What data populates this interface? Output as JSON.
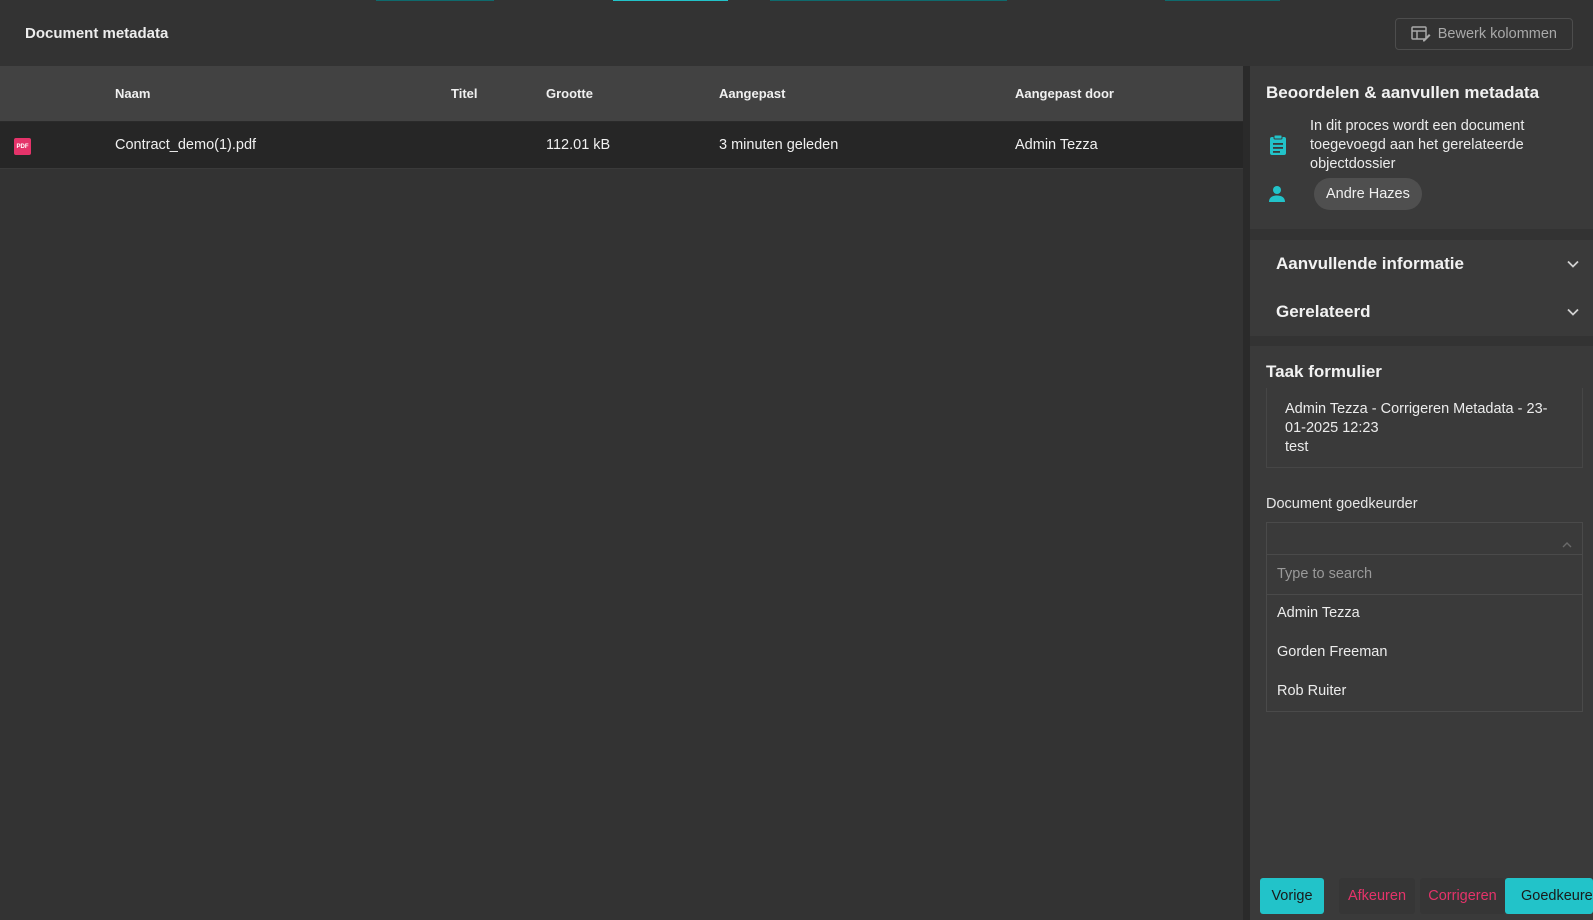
{
  "header": {
    "title": "Document metadata",
    "edit_columns_label": "Bewerk kolommen"
  },
  "table": {
    "columns": {
      "name": "Naam",
      "title": "Titel",
      "size": "Grootte",
      "modified": "Aangepast",
      "modified_by": "Aangepast door"
    },
    "rows": [
      {
        "icon": "pdf-file-icon",
        "icon_label": "PDF",
        "name": "Contract_demo(1).pdf",
        "title": "",
        "size": "112.01 kB",
        "modified": "3 minuten geleden",
        "modified_by": "Admin Tezza"
      }
    ]
  },
  "review_panel": {
    "title": "Beoordelen & aanvullen metadata",
    "description": "In dit proces wordt een document toegevoegd aan het gerelateerde objectdossier",
    "assignee": "Andre Hazes"
  },
  "accordion": {
    "items": [
      {
        "label": "Aanvullende informatie"
      },
      {
        "label": "Gerelateerd"
      }
    ]
  },
  "task_form": {
    "title": "Taak formulier",
    "comment_header": "Admin Tezza - Corrigeren Metadata - 23-01-2025 12:23",
    "comment_body": "test",
    "approver_field_label": "Document goedkeurder",
    "approver_value": "",
    "search_placeholder": "Type to search",
    "options": [
      "Admin Tezza",
      "Gorden Freeman",
      "Rob Ruiter"
    ]
  },
  "actions": {
    "previous": "Vorige",
    "reject": "Afkeuren",
    "correct": "Corrigeren",
    "approve": "Goedkeuren"
  },
  "colors": {
    "accent": "#22c3c9",
    "danger": "#e5336a",
    "background": "#333333",
    "panel": "#3a3a3a"
  }
}
